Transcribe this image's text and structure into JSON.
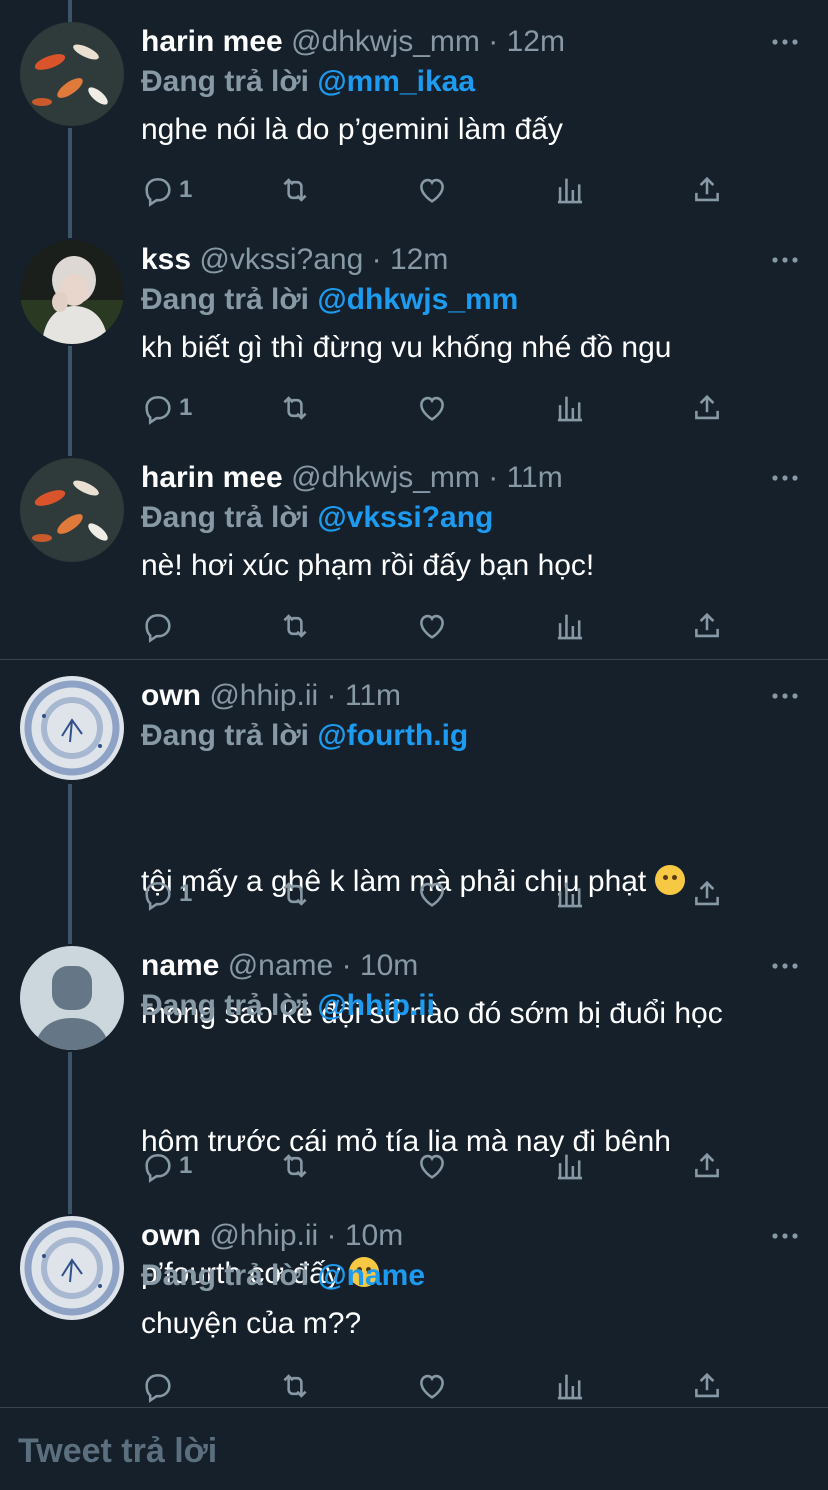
{
  "tweets": [
    {
      "name": "harin mee",
      "handle": "@dhkwjs_mm",
      "dot": "·",
      "time": "12m",
      "replying_label": "Đang trả lời",
      "replying_to": "@mm_ikaa",
      "text": "nghe nói là do p’gemini làm đấy",
      "reply_count": "1"
    },
    {
      "name": "kss",
      "handle": "@vkssi?ang",
      "dot": "·",
      "time": "12m",
      "replying_label": "Đang trả lời",
      "replying_to": "@dhkwjs_mm",
      "text": "kh biết gì thì đừng vu khống nhé đồ ngu",
      "reply_count": "1"
    },
    {
      "name": "harin mee",
      "handle": "@dhkwjs_mm",
      "dot": "·",
      "time": "11m",
      "replying_label": "Đang trả lời",
      "replying_to": "@vkssi?ang",
      "text": "nè! hơi xúc phạm rồi đấy bạn học!",
      "reply_count": ""
    },
    {
      "name": "own",
      "handle": "@hhip.ii",
      "dot": "·",
      "time": "11m",
      "replying_label": "Đang trả lời",
      "replying_to": "@fourth.ig",
      "text_line1": "tội mấy a ghê k làm mà phải chịu phạt",
      "text_line2": "mong sao kẻ đội sổ nào đó sớm bị đuổi học",
      "reply_count": "1"
    },
    {
      "name": "name",
      "handle": "@name",
      "dot": "·",
      "time": "10m",
      "replying_label": "Đang trả lời",
      "replying_to": "@hhip.ii",
      "text_line1": "hôm trước cái mỏ tía lia mà nay đi bênh",
      "text_line2": "p’fourth cơ đấy",
      "reply_count": "1"
    },
    {
      "name": "own",
      "handle": "@hhip.ii",
      "dot": "·",
      "time": "10m",
      "replying_label": "Đang trả lời",
      "replying_to": "@name",
      "text": "chuyện của m??",
      "reply_count": ""
    }
  ],
  "reply_placeholder": "Tweet trả lời",
  "icons": [
    "reply-icon",
    "retweet-icon",
    "like-icon",
    "analytics-icon",
    "share-icon",
    "more-icon"
  ],
  "colors": {
    "background": "#15202b",
    "accent": "#1d9bf0",
    "muted": "#8899a6",
    "divider": "#38444d"
  }
}
